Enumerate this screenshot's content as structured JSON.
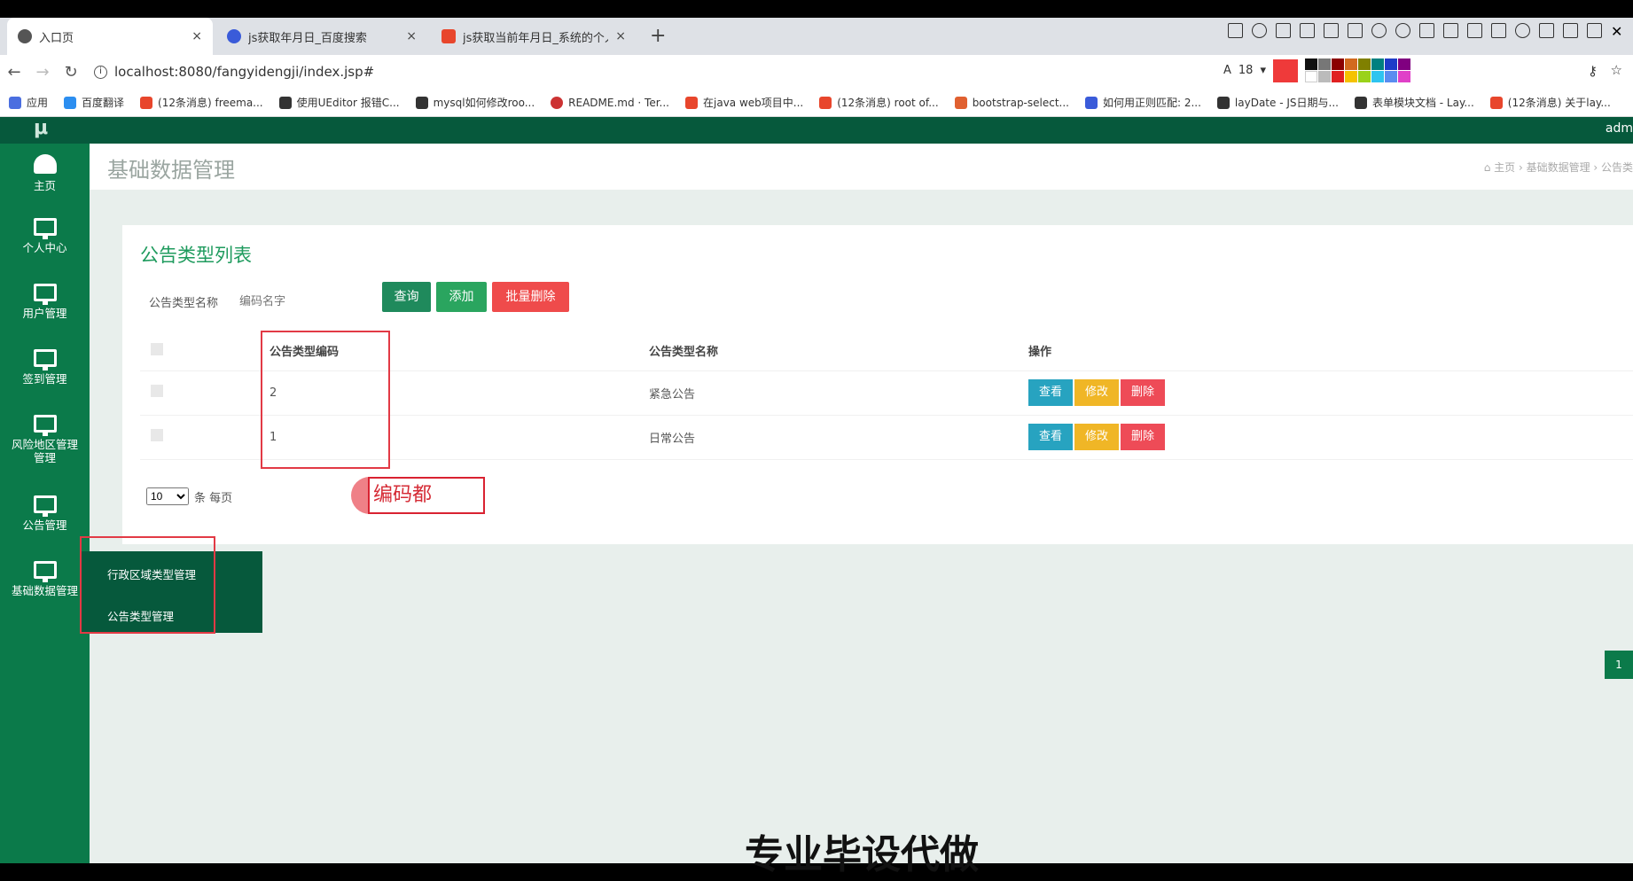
{
  "browser": {
    "tabs": [
      {
        "title": "入口页",
        "close": "×"
      },
      {
        "title": "js获取年月日_百度搜索",
        "close": "×"
      },
      {
        "title": "js获取当前年月日_系统的个人...",
        "close": "×"
      }
    ],
    "new_tab": "+",
    "url": "localhost:8080/fangyidengji/index.jsp#",
    "font_size_value": "18",
    "annotation_color": "#ef3a3a",
    "bookmarks": [
      "应用",
      "百度翻译",
      "(12条消息) freema...",
      "使用UEditor 报错C...",
      "mysql如何修改roo...",
      "README.md · Ter...",
      "在java web项目中...",
      "(12条消息) root of...",
      "bootstrap-select...",
      "如何用正则匹配: 2...",
      "layDate - JS日期与...",
      "表单模块文档 - Lay...",
      "(12条消息) 关于lay..."
    ]
  },
  "app": {
    "logo": "μ",
    "user": "adm",
    "sidebar": [
      {
        "label": "主页",
        "icon": "dashboard-icon"
      },
      {
        "label": "个人中心",
        "icon": "monitor-icon"
      },
      {
        "label": "用户管理",
        "icon": "monitor-icon"
      },
      {
        "label": "签到管理",
        "icon": "monitor-icon"
      },
      {
        "label": "风险地区管理",
        "label2": "管理",
        "icon": "monitor-icon"
      },
      {
        "label": "公告管理",
        "icon": "monitor-icon"
      },
      {
        "label": "基础数据管理",
        "icon": "monitor-icon"
      }
    ],
    "submenu": [
      "行政区域类型管理",
      "公告类型管理"
    ],
    "page_title": "基础数据管理",
    "breadcrumb": "主页 › 基础数据管理 › 公告类",
    "panel_title": "公告类型列表",
    "filter_label": "公告类型名称",
    "filter_placeholder": "编码名字",
    "buttons": {
      "query": "查询",
      "add": "添加",
      "batch_delete": "批量删除"
    },
    "table": {
      "headers": [
        "公告类型编码",
        "公告类型名称",
        "操作"
      ],
      "rows": [
        {
          "code": "2",
          "name": "紧急公告"
        },
        {
          "code": "1",
          "name": "日常公告"
        }
      ],
      "actions": {
        "view": "查看",
        "edit": "修改",
        "delete": "删除"
      }
    },
    "page_size": "10",
    "page_size_suffix": "条 每页",
    "page_number": "1",
    "typing_text": "编码都",
    "watermark": "专业毕设代做"
  }
}
